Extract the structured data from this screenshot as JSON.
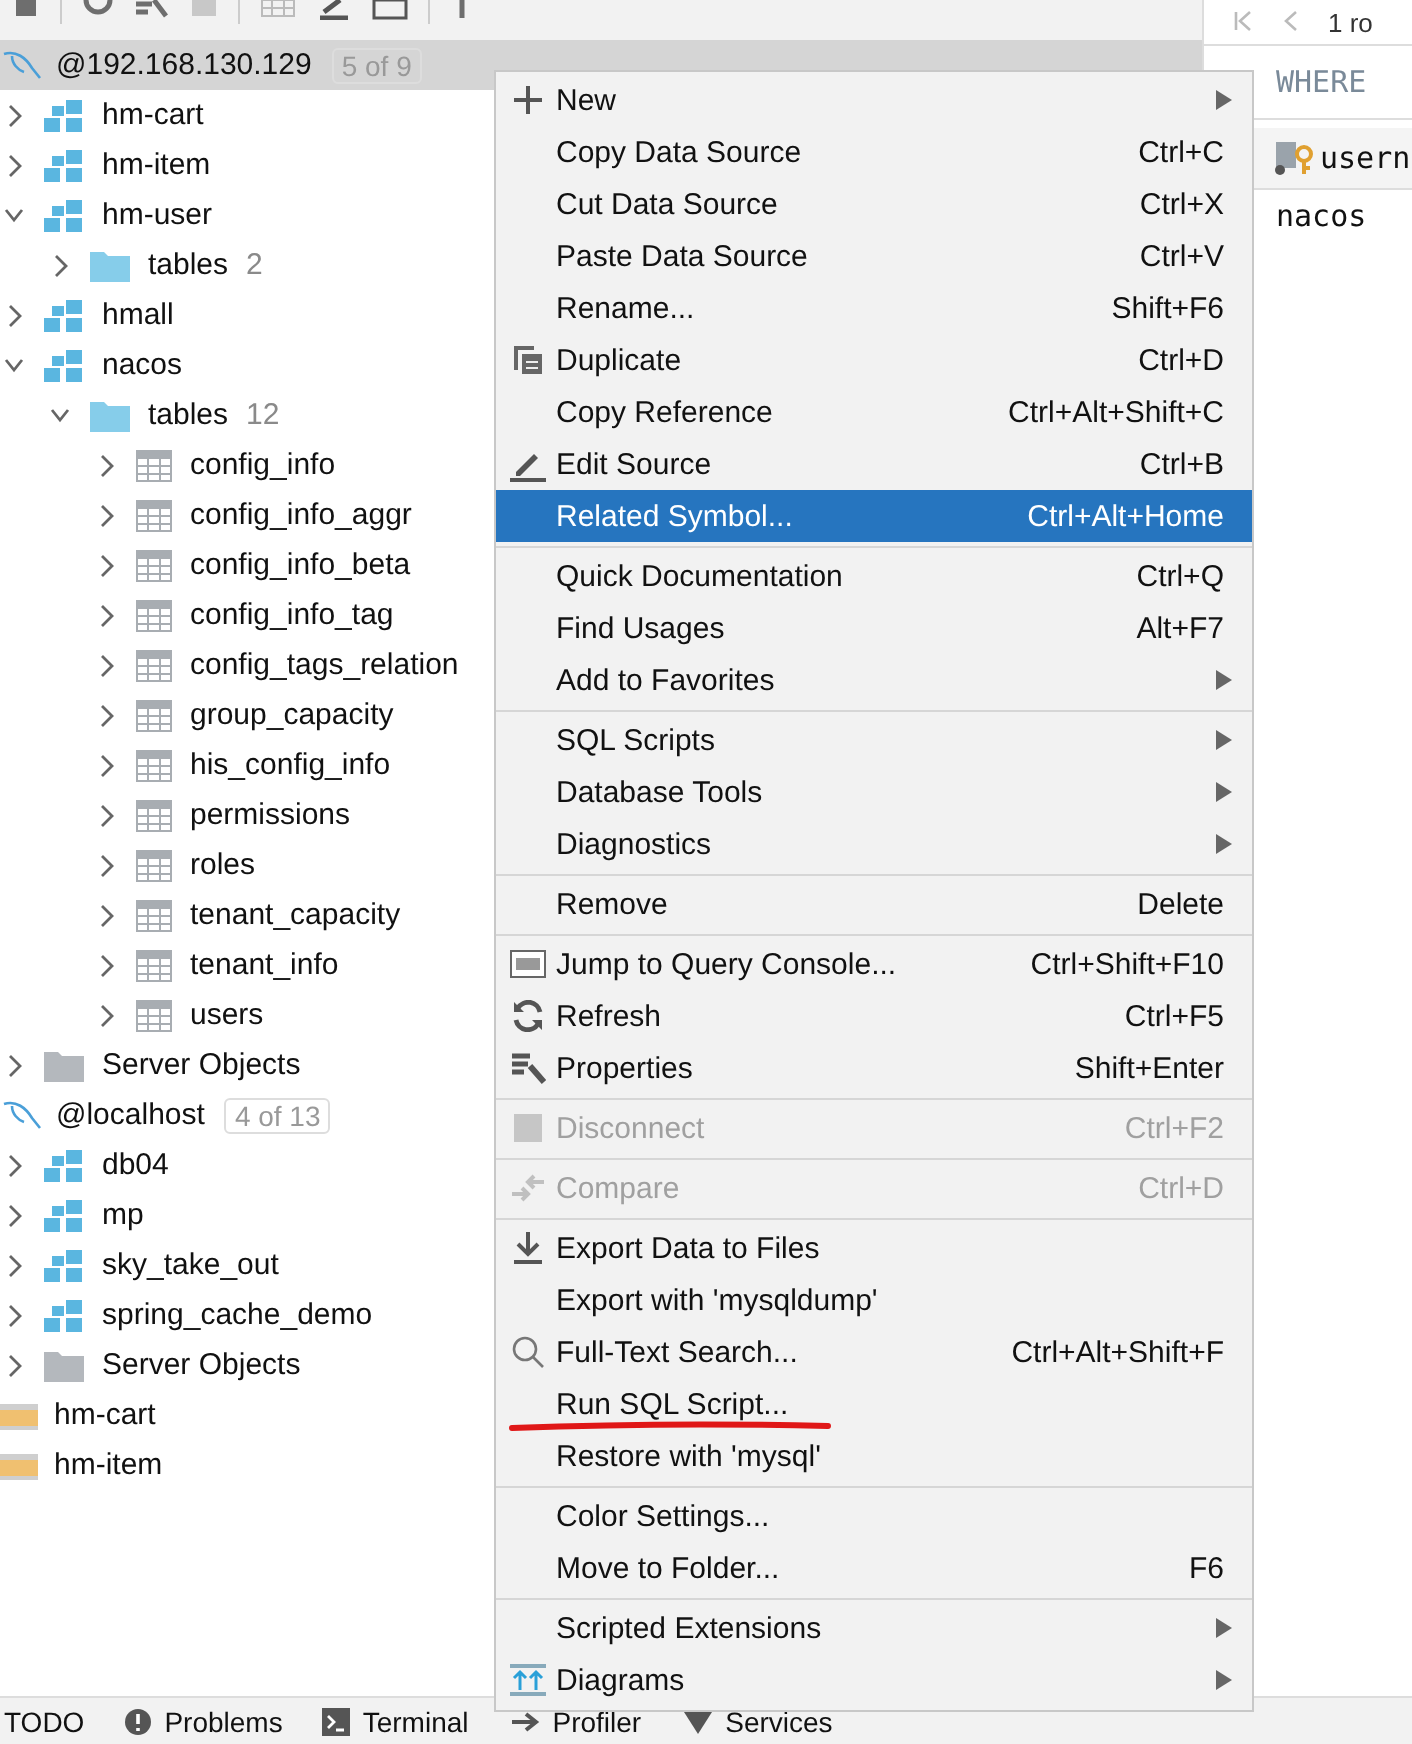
{
  "tree": [
    {
      "kind": "connection",
      "label": "@192.168.130.129",
      "badge": "5 of 9",
      "selected": true,
      "children": [
        {
          "kind": "schema",
          "label": "hm-cart",
          "expanded": false
        },
        {
          "kind": "schema",
          "label": "hm-item",
          "expanded": false
        },
        {
          "kind": "schema",
          "label": "hm-user",
          "expanded": true,
          "children": [
            {
              "kind": "folder",
              "label": "tables",
              "count": "2",
              "expanded": false
            }
          ]
        },
        {
          "kind": "schema",
          "label": "hmall",
          "expanded": false
        },
        {
          "kind": "schema",
          "label": "nacos",
          "expanded": true,
          "children": [
            {
              "kind": "folder",
              "label": "tables",
              "count": "12",
              "expanded": true,
              "children": [
                {
                  "kind": "table",
                  "label": "config_info",
                  "expanded": false
                },
                {
                  "kind": "table",
                  "label": "config_info_aggr",
                  "expanded": false
                },
                {
                  "kind": "table",
                  "label": "config_info_beta",
                  "expanded": false
                },
                {
                  "kind": "table",
                  "label": "config_info_tag",
                  "expanded": false
                },
                {
                  "kind": "table",
                  "label": "config_tags_relation",
                  "expanded": false
                },
                {
                  "kind": "table",
                  "label": "group_capacity",
                  "expanded": false
                },
                {
                  "kind": "table",
                  "label": "his_config_info",
                  "expanded": false
                },
                {
                  "kind": "table",
                  "label": "permissions",
                  "expanded": false
                },
                {
                  "kind": "table",
                  "label": "roles",
                  "expanded": false
                },
                {
                  "kind": "table",
                  "label": "tenant_capacity",
                  "expanded": false
                },
                {
                  "kind": "table",
                  "label": "tenant_info",
                  "expanded": false
                },
                {
                  "kind": "table",
                  "label": "users",
                  "expanded": false
                }
              ]
            }
          ]
        },
        {
          "kind": "server-objects",
          "label": "Server Objects",
          "expanded": false
        }
      ]
    },
    {
      "kind": "connection",
      "label": "@localhost",
      "badge": "4 of 13",
      "selected": false,
      "children": [
        {
          "kind": "schema",
          "label": "db04",
          "expanded": false
        },
        {
          "kind": "schema",
          "label": "mp",
          "expanded": false
        },
        {
          "kind": "schema",
          "label": "sky_take_out",
          "expanded": false
        },
        {
          "kind": "schema",
          "label": "spring_cache_demo",
          "expanded": false
        },
        {
          "kind": "server-objects",
          "label": "Server Objects",
          "expanded": false
        }
      ]
    },
    {
      "kind": "ddl",
      "label": "hm-cart"
    },
    {
      "kind": "ddl",
      "label": "hm-item"
    }
  ],
  "results": {
    "row_count": "1 ro",
    "filter": "WHERE",
    "column": "usern",
    "cell": "nacos"
  },
  "status_bar": [
    {
      "kind": "todo",
      "label": "TODO"
    },
    {
      "kind": "problems",
      "label": "Problems"
    },
    {
      "kind": "terminal",
      "label": "Terminal"
    },
    {
      "kind": "profiler",
      "label": "Profiler"
    },
    {
      "kind": "services",
      "label": "Services"
    }
  ],
  "menu": [
    [
      {
        "kind": "plus",
        "label": "New",
        "submenu": true,
        "disabled": false,
        "selected": false
      },
      {
        "kind": "plain",
        "label": "Copy Data Source",
        "shortcut": "Ctrl+C",
        "disabled": false,
        "selected": false
      },
      {
        "kind": "plain",
        "label": "Cut Data Source",
        "shortcut": "Ctrl+X",
        "disabled": false,
        "selected": false
      },
      {
        "kind": "plain",
        "label": "Paste Data Source",
        "shortcut": "Ctrl+V",
        "disabled": false,
        "selected": false
      },
      {
        "kind": "plain",
        "label": "Rename...",
        "shortcut": "Shift+F6",
        "disabled": false,
        "selected": false
      },
      {
        "kind": "duplicate",
        "label": "Duplicate",
        "shortcut": "Ctrl+D",
        "disabled": false,
        "selected": false
      },
      {
        "kind": "plain",
        "label": "Copy Reference",
        "shortcut": "Ctrl+Alt+Shift+C",
        "disabled": false,
        "selected": false
      },
      {
        "kind": "edit",
        "label": "Edit Source",
        "shortcut": "Ctrl+B",
        "disabled": false,
        "selected": false
      },
      {
        "kind": "plain",
        "label": "Related Symbol...",
        "shortcut": "Ctrl+Alt+Home",
        "disabled": false,
        "selected": true
      }
    ],
    [
      {
        "kind": "plain",
        "label": "Quick Documentation",
        "shortcut": "Ctrl+Q",
        "disabled": false,
        "selected": false
      },
      {
        "kind": "plain",
        "label": "Find Usages",
        "shortcut": "Alt+F7",
        "disabled": false,
        "selected": false
      },
      {
        "kind": "plain",
        "label": "Add to Favorites",
        "submenu": true,
        "disabled": false,
        "selected": false
      }
    ],
    [
      {
        "kind": "plain",
        "label": "SQL Scripts",
        "submenu": true,
        "disabled": false,
        "selected": false
      },
      {
        "kind": "plain",
        "label": "Database Tools",
        "submenu": true,
        "disabled": false,
        "selected": false
      },
      {
        "kind": "plain",
        "label": "Diagnostics",
        "submenu": true,
        "disabled": false,
        "selected": false
      }
    ],
    [
      {
        "kind": "plain",
        "label": "Remove",
        "shortcut": "Delete",
        "disabled": false,
        "selected": false
      }
    ],
    [
      {
        "kind": "console",
        "label": "Jump to Query Console...",
        "shortcut": "Ctrl+Shift+F10",
        "disabled": false,
        "selected": false
      },
      {
        "kind": "refresh",
        "label": "Refresh",
        "shortcut": "Ctrl+F5",
        "disabled": false,
        "selected": false
      },
      {
        "kind": "properties",
        "label": "Properties",
        "shortcut": "Shift+Enter",
        "disabled": false,
        "selected": false
      }
    ],
    [
      {
        "kind": "disconnect",
        "label": "Disconnect",
        "shortcut": "Ctrl+F2",
        "disabled": true,
        "selected": false
      }
    ],
    [
      {
        "kind": "compare",
        "label": "Compare",
        "shortcut": "Ctrl+D",
        "disabled": true,
        "selected": false
      }
    ],
    [
      {
        "kind": "export",
        "label": "Export Data to Files",
        "disabled": false,
        "selected": false
      },
      {
        "kind": "plain",
        "label": "Export with 'mysqldump'",
        "disabled": false,
        "selected": false
      },
      {
        "kind": "search",
        "label": "Full-Text Search...",
        "shortcut": "Ctrl+Alt+Shift+F",
        "disabled": false,
        "selected": false
      },
      {
        "kind": "plain",
        "label": "Run SQL Script...",
        "disabled": false,
        "selected": false,
        "annotated": true
      },
      {
        "kind": "plain",
        "label": "Restore with 'mysql'",
        "disabled": false,
        "selected": false
      }
    ],
    [
      {
        "kind": "plain",
        "label": "Color Settings...",
        "disabled": false,
        "selected": false
      },
      {
        "kind": "plain",
        "label": "Move to Folder...",
        "shortcut": "F6",
        "disabled": false,
        "selected": false
      }
    ],
    [
      {
        "kind": "plain",
        "label": "Scripted Extensions",
        "submenu": true,
        "disabled": false,
        "selected": false
      },
      {
        "kind": "diagram",
        "label": "Diagrams",
        "submenu": true,
        "disabled": false,
        "selected": false
      }
    ]
  ]
}
